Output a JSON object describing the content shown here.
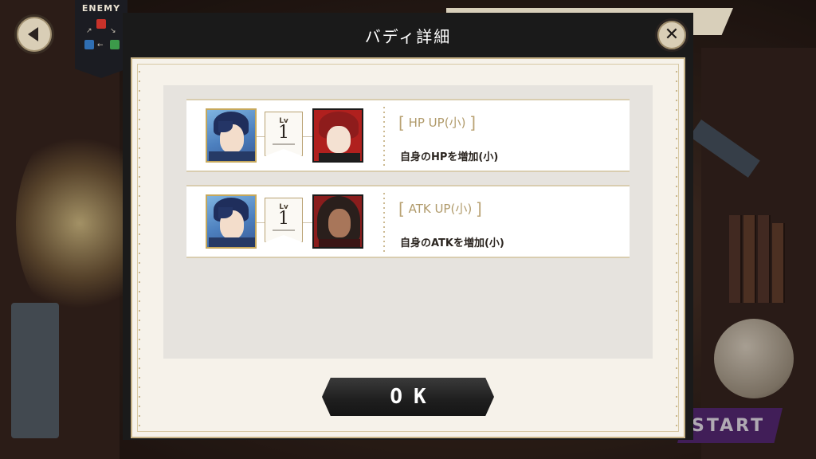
{
  "header": {
    "title": "バディ詳細",
    "enemy_label": "ENEMY"
  },
  "background": {
    "start_label": "START"
  },
  "buddies": [
    {
      "level_label": "Lv",
      "level": "1",
      "skill_name": "HP UP(小)",
      "skill_description": "自身のHPを増加(小)",
      "partner_color": "#b0201e"
    },
    {
      "level_label": "Lv",
      "level": "1",
      "skill_name": "ATK UP(小)",
      "skill_description": "自身のATKを増加(小)",
      "partner_color": "#8a1d1d"
    }
  ],
  "footer": {
    "ok_label": "OK"
  },
  "icons": {
    "back": "chevron-left-icon",
    "close": "close-icon"
  },
  "colors": {
    "accent_gold": "#c4ad77",
    "panel_dark": "#1a1a1a",
    "paper": "#f6f2ea"
  }
}
